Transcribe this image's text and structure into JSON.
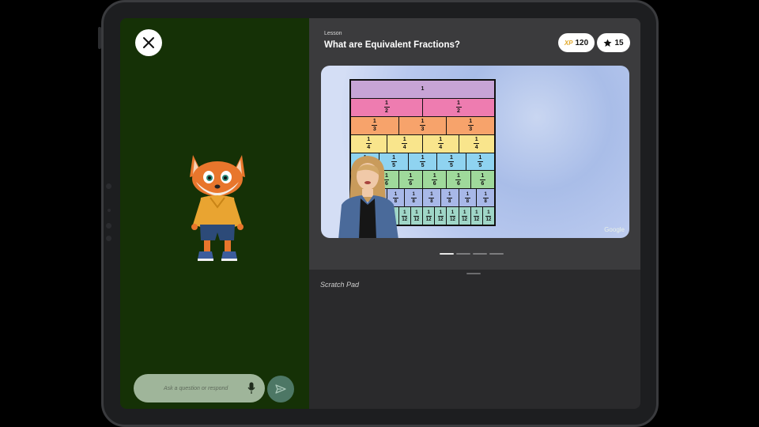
{
  "lesson": {
    "label": "Lesson",
    "title": "What are Equivalent Fractions?"
  },
  "stats": {
    "xp_label": "XP",
    "xp_value": "120",
    "stars_value": "15"
  },
  "video": {
    "watermark": "Google"
  },
  "fraction_wall": [
    {
      "denominator": "",
      "parts": 1,
      "color": "#c7a4d6",
      "label": "1"
    },
    {
      "denominator": "2",
      "parts": 2,
      "color": "#ee7cb0"
    },
    {
      "denominator": "3",
      "parts": 3,
      "color": "#f7a36b"
    },
    {
      "denominator": "4",
      "parts": 4,
      "color": "#f9e58c"
    },
    {
      "denominator": "5",
      "parts": 5,
      "color": "#8fd3f0"
    },
    {
      "denominator": "6",
      "parts": 6,
      "color": "#9fd99b"
    },
    {
      "denominator": "8",
      "parts": 8,
      "color": "#a8b8e8"
    },
    {
      "denominator": "12",
      "parts": 12,
      "color": "#9fd6c7"
    }
  ],
  "scratch_pad": {
    "label": "Scratch Pad"
  },
  "chat": {
    "placeholder": "Ask a question or respond"
  },
  "carousel": {
    "count": 4,
    "active": 0
  },
  "colors": {
    "left_panel": "#153106",
    "send_button": "#4d7765"
  }
}
